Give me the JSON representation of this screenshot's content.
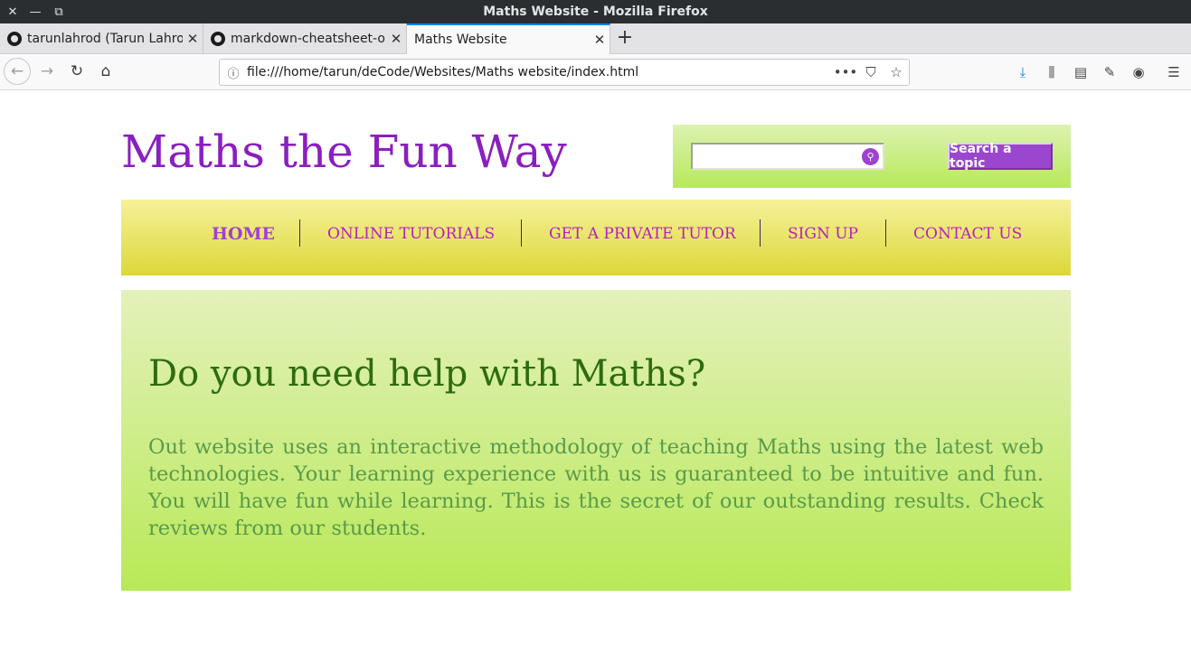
{
  "window": {
    "title": "Maths Website - Mozilla Firefox",
    "close_glyph": "✕",
    "minimize_glyph": "—",
    "restore_glyph": "⧉"
  },
  "tabs": [
    {
      "label": "tarunlahrod (Tarun Lahrod)",
      "icon": "github-icon",
      "active": false
    },
    {
      "label": "markdown-cheatsheet-online",
      "icon": "github-icon",
      "active": false
    },
    {
      "label": "Maths Website",
      "icon": "none",
      "active": true
    }
  ],
  "tab_close_glyph": "✕",
  "new_tab_glyph": "+",
  "navbar": {
    "back_glyph": "←",
    "forward_glyph": "→",
    "reload_glyph": "↻",
    "home_glyph": "⌂",
    "info_glyph": "ⓘ",
    "url": "file:///home/tarun/deCode/Websites/Maths website/index.html",
    "more_glyph": "•••",
    "pocket_glyph": "⛉",
    "star_glyph": "☆",
    "download_glyph": "⤓",
    "library_glyph": "⫼",
    "sidebar_glyph": "▤",
    "extension_glyph": "✎",
    "account_glyph": "◉",
    "menu_glyph": "☰"
  },
  "site": {
    "title": "Maths the Fun Way",
    "search": {
      "placeholder": "",
      "icon_glyph": "⚲",
      "button_label": "Search a topic"
    },
    "menu": [
      {
        "label": "HOME",
        "active": true
      },
      {
        "label": "ONLINE TUTORIALS",
        "active": false
      },
      {
        "label": "GET A PRIVATE TUTOR",
        "active": false
      },
      {
        "label": "SIGN UP",
        "active": false
      },
      {
        "label": "CONTACT US",
        "active": false
      }
    ],
    "hero": {
      "title": "Do you need help with Maths?",
      "text": "Out website uses an interactive methodology of teaching Maths using the latest web technologies. Your learning experience with us is guaranteed to be intuitive and fun. You will have fun while learning. This is the secret of our outstanding results. Check reviews from our students."
    }
  },
  "colors": {
    "accent_purple": "#8a1fbf",
    "menu_text": "#b61fc0",
    "hero_title": "#2f6b10",
    "hero_text": "#5a9a4a",
    "tab_active_border": "#0a84ff"
  }
}
